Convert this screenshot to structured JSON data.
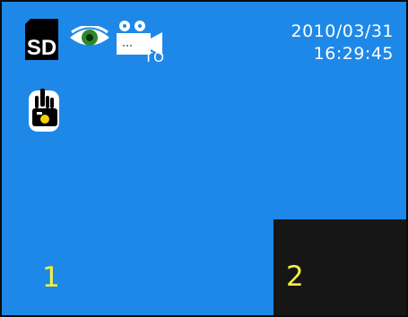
{
  "status_bar": {
    "storage_label": "SD",
    "camera_sub_label": "TO",
    "date": "2010/03/31",
    "time": "16:29:45"
  },
  "regions": [
    {
      "label": "1"
    },
    {
      "label": "2"
    }
  ],
  "icons": [
    "sd-card-icon",
    "eye-icon",
    "video-camera-icon",
    "hand-camera-icon"
  ],
  "colors": {
    "screen_background": "#1e88e8",
    "region_2_background": "#161616",
    "region_label": "#f5f03a",
    "text": "#ffffff"
  }
}
